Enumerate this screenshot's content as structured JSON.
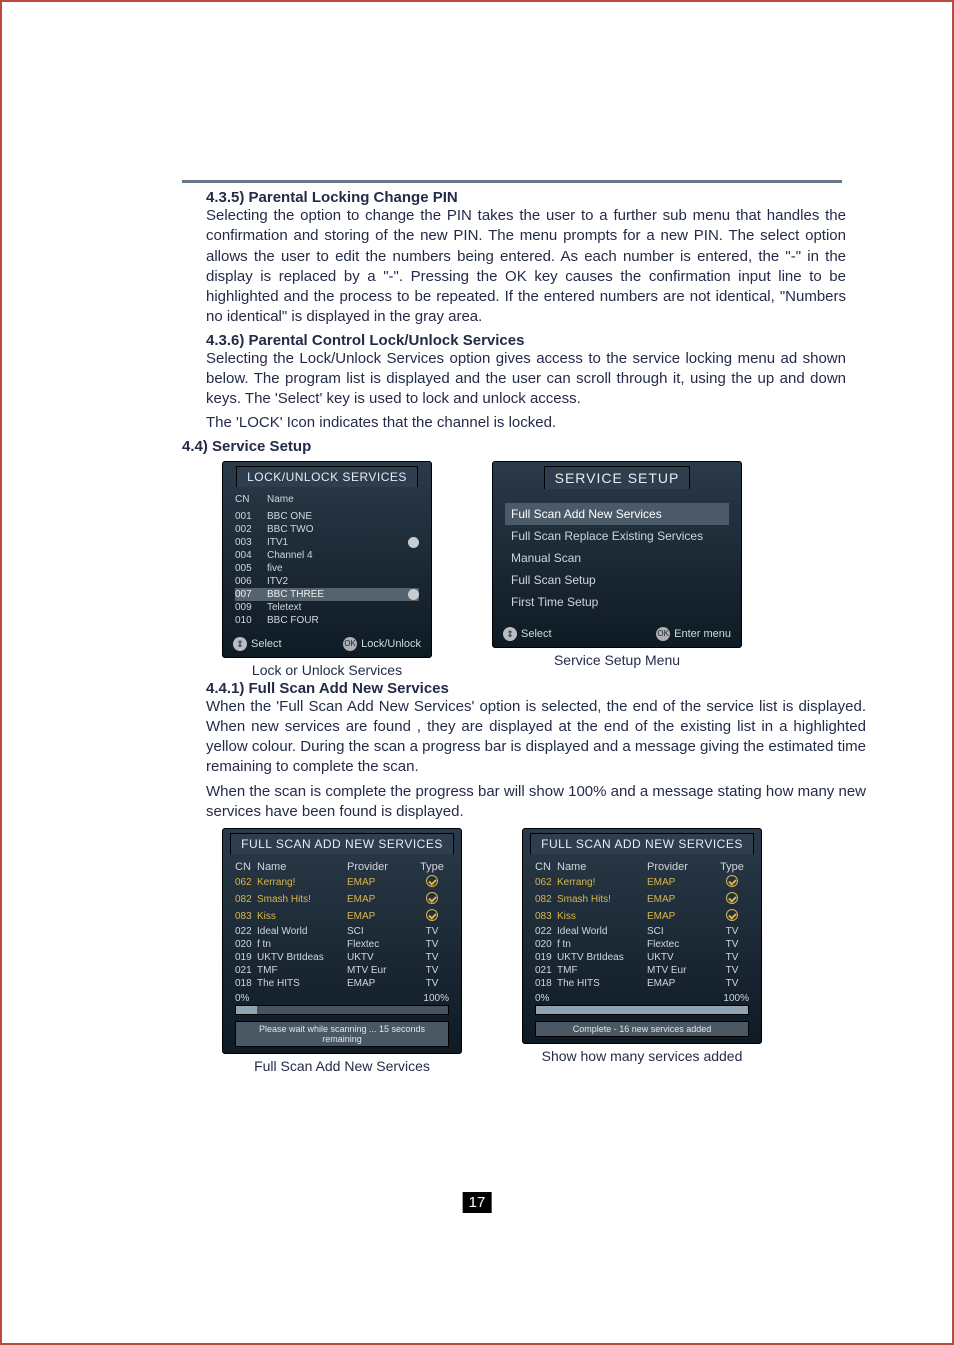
{
  "page_number": "17",
  "section_435": {
    "heading": "4.3.5) Parental Locking  Change PIN",
    "para": "Selecting the option to change the PIN takes the user to a further sub menu that handles the confirmation and storing of the new PIN. The menu prompts for a new PIN. The select option allows the user to edit the numbers being entered. As each number is entered, the \"-\" in the display is replaced by a \"-\". Pressing the OK key causes the confirmation input line to be highlighted and the process to be repeated. If the entered numbers are not identical, \"Numbers no identical\" is displayed in the gray area."
  },
  "section_436": {
    "heading": "4.3.6) Parental Control  Lock/Unlock Services",
    "para1": "Selecting the Lock/Unlock Services option gives access to the service locking menu ad shown below. The program list is displayed and the user can scroll through it, using the up and down keys. The 'Select' key is used to lock and unlock access.",
    "para2": "The 'LOCK' Icon indicates that the channel is locked."
  },
  "section_44": {
    "heading": "4.4) Service Setup"
  },
  "lock_osd": {
    "title": "LOCK/UNLOCK SERVICES",
    "col_cn": "CN",
    "col_name": "Name",
    "rows": [
      {
        "cn": "001",
        "name": "BBC ONE",
        "locked": false,
        "hl": false
      },
      {
        "cn": "002",
        "name": "BBC TWO",
        "locked": false,
        "hl": false
      },
      {
        "cn": "003",
        "name": "ITV1",
        "locked": true,
        "hl": false
      },
      {
        "cn": "004",
        "name": "Channel 4",
        "locked": false,
        "hl": false
      },
      {
        "cn": "005",
        "name": "five",
        "locked": false,
        "hl": false
      },
      {
        "cn": "006",
        "name": "ITV2",
        "locked": false,
        "hl": false
      },
      {
        "cn": "007",
        "name": "BBC THREE",
        "locked": true,
        "hl": true
      },
      {
        "cn": "009",
        "name": "Teletext",
        "locked": false,
        "hl": false
      },
      {
        "cn": "010",
        "name": "BBC FOUR",
        "locked": false,
        "hl": false
      }
    ],
    "foot_left": "Select",
    "foot_right": "Lock/Unlock",
    "caption": "Lock or Unlock Services"
  },
  "setup_osd": {
    "title": "SERVICE SETUP",
    "items": [
      {
        "label": "Full Scan Add New Services",
        "hl": true
      },
      {
        "label": "Full Scan Replace Existing Services",
        "hl": false
      },
      {
        "label": "Manual Scan",
        "hl": false
      },
      {
        "label": "Full Scan Setup",
        "hl": false
      },
      {
        "label": "First Time Setup",
        "hl": false
      }
    ],
    "foot_left": "Select",
    "foot_right": "Enter menu",
    "caption": "Service Setup Menu"
  },
  "section_441": {
    "heading": "4.4.1) Full Scan Add New Services",
    "para1": "When the 'Full Scan Add New Services' option is selected, the end of the service list is displayed. When new services are found , they are displayed at the end of the existing list in a highlighted yellow colour. During the scan a progress bar is displayed and a message giving the estimated time remaining to complete the scan.",
    "para2": "When the scan is complete the progress bar will show 100% and a message stating how many new services have been found is displayed."
  },
  "scan1": {
    "title": "FULL SCAN ADD NEW SERVICES",
    "head": {
      "cn": "CN",
      "name": "Name",
      "prov": "Provider",
      "type": "Type"
    },
    "rows": [
      {
        "cn": "062",
        "name": "Kerrang!",
        "prov": "EMAP",
        "type": "radio",
        "new": true
      },
      {
        "cn": "082",
        "name": "Smash Hits!",
        "prov": "EMAP",
        "type": "radio",
        "new": true
      },
      {
        "cn": "083",
        "name": "Kiss",
        "prov": "EMAP",
        "type": "radio",
        "new": true
      },
      {
        "cn": "022",
        "name": "Ideal World",
        "prov": "SCI",
        "type": "TV",
        "new": false
      },
      {
        "cn": "020",
        "name": "f tn",
        "prov": "Flextec",
        "type": "TV",
        "new": false
      },
      {
        "cn": "019",
        "name": "UKTV BrtIdeas",
        "prov": "UKTV",
        "type": "TV",
        "new": false
      },
      {
        "cn": "021",
        "name": "TMF",
        "prov": "MTV Eur",
        "type": "TV",
        "new": false
      },
      {
        "cn": "018",
        "name": "The HITS",
        "prov": "EMAP",
        "type": "TV",
        "new": false
      }
    ],
    "progress_left": "0%",
    "progress_right": "100%",
    "progress_fill": 10,
    "status": "Please wait while scanning ... 15 seconds remaining",
    "caption": "Full Scan Add New Services"
  },
  "scan2": {
    "title": "FULL SCAN ADD NEW SERVICES",
    "head": {
      "cn": "CN",
      "name": "Name",
      "prov": "Provider",
      "type": "Type"
    },
    "rows": [
      {
        "cn": "062",
        "name": "Kerrang!",
        "prov": "EMAP",
        "type": "radio",
        "new": true
      },
      {
        "cn": "082",
        "name": "Smash Hits!",
        "prov": "EMAP",
        "type": "radio",
        "new": true
      },
      {
        "cn": "083",
        "name": "Kiss",
        "prov": "EMAP",
        "type": "radio",
        "new": true
      },
      {
        "cn": "022",
        "name": "Ideal World",
        "prov": "SCI",
        "type": "TV",
        "new": false
      },
      {
        "cn": "020",
        "name": "f tn",
        "prov": "Flextec",
        "type": "TV",
        "new": false
      },
      {
        "cn": "019",
        "name": "UKTV BrtIdeas",
        "prov": "UKTV",
        "type": "TV",
        "new": false
      },
      {
        "cn": "021",
        "name": "TMF",
        "prov": "MTV Eur",
        "type": "TV",
        "new": false
      },
      {
        "cn": "018",
        "name": "The HITS",
        "prov": "EMAP",
        "type": "TV",
        "new": false
      }
    ],
    "progress_left": "0%",
    "progress_right": "100%",
    "progress_fill": 100,
    "status": "Complete - 16 new services added",
    "caption": "Show how many services added"
  },
  "key_ok": "OK"
}
